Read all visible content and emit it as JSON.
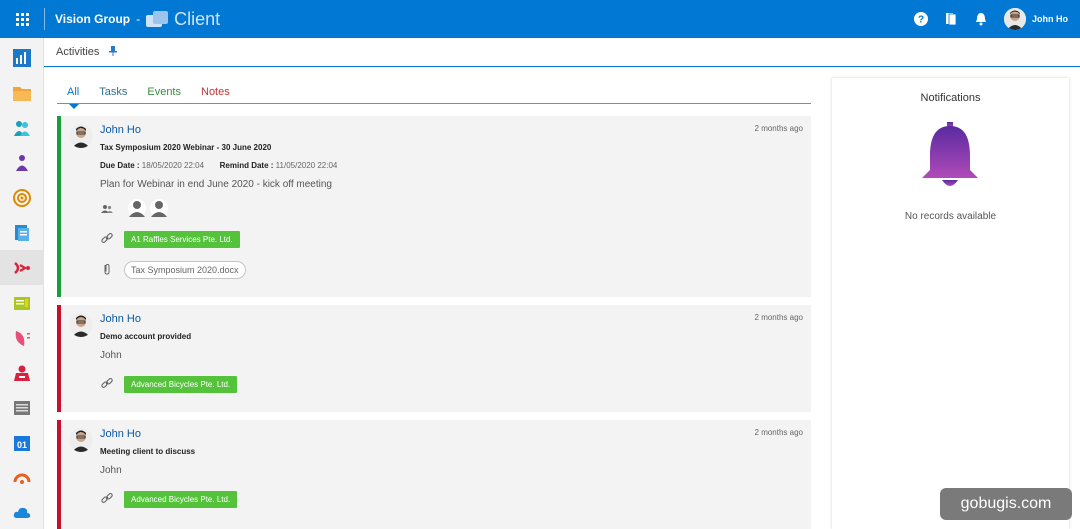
{
  "topbar": {
    "org": "Vision Group",
    "separator": "-",
    "app_title": "Client",
    "user_name": "John Ho"
  },
  "activities_bar": {
    "label": "Activities"
  },
  "tabs": [
    {
      "label": "All",
      "active": true
    },
    {
      "label": "Tasks",
      "active": false
    },
    {
      "label": "Events",
      "active": false
    },
    {
      "label": "Notes",
      "active": false
    }
  ],
  "cards": [
    {
      "author": "John Ho",
      "time_ago": "2 months ago",
      "subject": "Tax Symposium 2020 Webinar - 30 June 2020",
      "due_label": "Due Date :",
      "due_value": "18/05/2020 22:04",
      "remind_label": "Remind Date :",
      "remind_value": "11/05/2020 22:04",
      "description": "Plan for Webinar in end June 2020 - kick off meeting",
      "linked": "A1 Raffles Services Pte. Ltd.",
      "attachment": "Tax Symposium 2020.docx",
      "accent": "#1a9e3a"
    },
    {
      "author": "John Ho",
      "time_ago": "2 months ago",
      "subject": "Demo account provided",
      "description": "John",
      "linked": "Advanced Bicycles Pte. Ltd.",
      "accent": "#c8102e"
    },
    {
      "author": "John Ho",
      "time_ago": "2 months ago",
      "subject": "Meeting client to discuss",
      "description": "John",
      "linked": "Advanced Bicycles Pte. Ltd.",
      "accent": "#c8102e"
    }
  ],
  "notifications": {
    "title": "Notifications",
    "empty_text": "No records available"
  },
  "watermark": "gobugis.com",
  "colors": {
    "topbar": "#0078d4",
    "tag_green": "#55c23c",
    "bell_top": "#5a2aa0",
    "bell_bottom": "#b04ab8"
  }
}
